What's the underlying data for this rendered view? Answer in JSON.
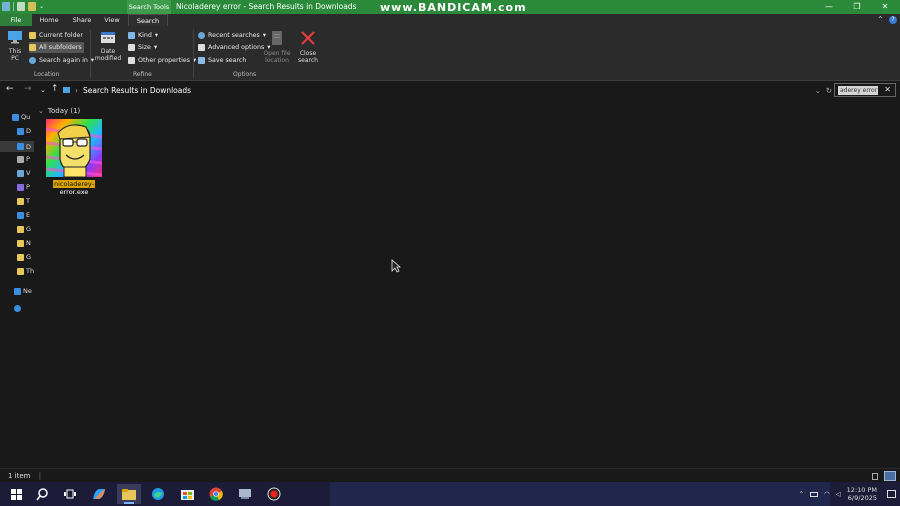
{
  "titlebar": {
    "context_tab": "Search Tools",
    "window_title": "Nicoladerey error - Search Results in Downloads",
    "watermark": "www.BANDICAM.com",
    "minimize": "—",
    "maximize": "❐",
    "close": "✕"
  },
  "tabs": {
    "file": "File",
    "home": "Home",
    "share": "Share",
    "view": "View",
    "search": "Search"
  },
  "ribbon": {
    "this_pc": "This PC",
    "current_folder": "Current folder",
    "all_subfolders": "All subfolders",
    "search_again_in": "Search again in",
    "location_label": "Location",
    "date_modified": "Date modified",
    "kind": "Kind",
    "size": "Size",
    "other_properties": "Other properties",
    "refine_label": "Refine",
    "recent_searches": "Recent searches",
    "advanced_options": "Advanced options",
    "save_search": "Save search",
    "open_file_location": "Open file location",
    "options_label": "Options",
    "close_search": "Close search"
  },
  "address": {
    "path": "Search Results in Downloads",
    "search_value": "aderey error"
  },
  "nav_pane": {
    "items": [
      "Qu",
      "D",
      "D",
      "P",
      "V",
      "P",
      "T",
      "E",
      "G",
      "N",
      "G",
      "Th",
      "Ne"
    ]
  },
  "content": {
    "group_header": "Today (1)",
    "file_name_line1": "nicoladerey-",
    "file_name_line2": "error.exe"
  },
  "status": {
    "count": "1 item"
  },
  "taskbar": {
    "time": "12:10 PM",
    "date": "6/9/2025"
  },
  "colors": {
    "titlebar": "#2a8a3a",
    "highlight": "#d9a400",
    "ribbon_bg": "#2b2b2b",
    "content_bg": "#191919"
  }
}
